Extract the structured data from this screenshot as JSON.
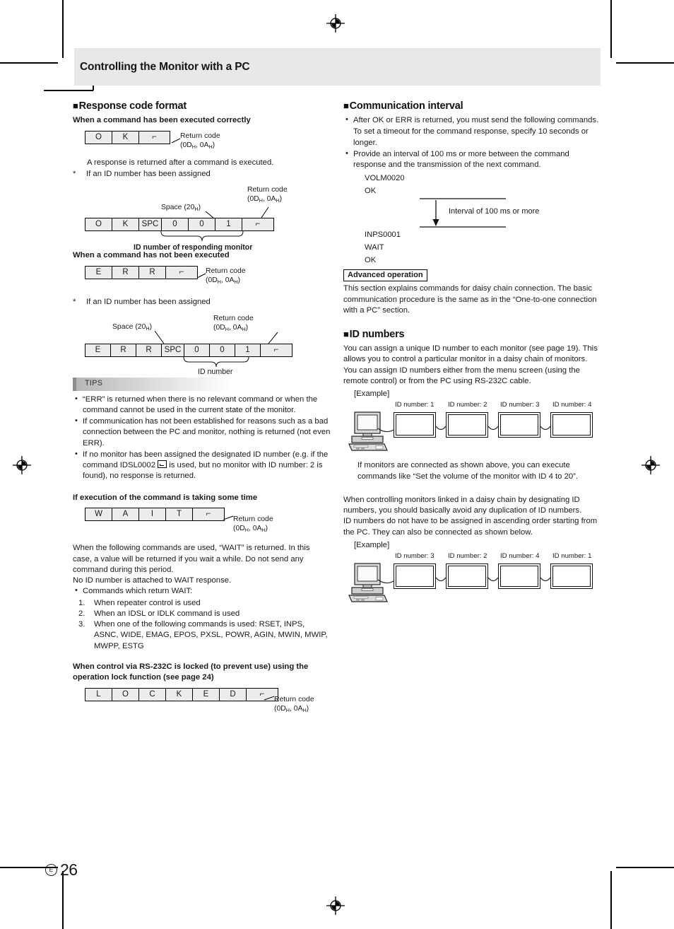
{
  "page": {
    "header_title": "Controlling the Monitor with a PC",
    "page_number": "26",
    "page_mark": "E"
  },
  "left": {
    "s1": {
      "heading": "Response code format",
      "sub1": "When a command has been executed correctly",
      "ok_cells": [
        "O",
        "K",
        "⌐"
      ],
      "return_code_label": "Return code",
      "return_code_hex": "(0DH, 0AH)",
      "note": "A response is returned after a command is executed.",
      "star_note": "If an ID number has been assigned",
      "space_label": "Space (20H)",
      "ok_id_cells": [
        "O",
        "K",
        "SPC",
        "0",
        "0",
        "1",
        "⌐"
      ],
      "brace_label": "ID number of responding monitor",
      "sub2": "When a command has not been executed",
      "err_cells": [
        "E",
        "R",
        "R",
        "⌐"
      ],
      "err_id_cells": [
        "E",
        "R",
        "R",
        "SPC",
        "0",
        "0",
        "1",
        "⌐"
      ],
      "brace_label2": "ID number"
    },
    "tips": {
      "title": "TIPS",
      "items": [
        "“ERR” is returned when there is no relevant command or when the command cannot be used in the current state of the monitor.",
        "If communication has not been established for reasons such as a bad connection between the PC and monitor, nothing is returned (not even ERR).",
        "If no monitor has been assigned the designated ID number (e.g. if the command IDSL0002 ☐ is used, but no monitor with ID number: 2 is found), no response is returned."
      ],
      "item3_pre": "If no monitor has been assigned the designated ID number (e.g. if the command IDSL0002 ",
      "item3_post": " is used, but no monitor with ID number: 2 is found), no response is returned."
    },
    "s2": {
      "sub": "If execution of the command is taking some time",
      "wait_cells": [
        "W",
        "A",
        "I",
        "T",
        "⌐"
      ],
      "p1": "When the following commands are used, “WAIT” is returned. In this case, a value will be returned if you wait a while. Do not send any command during this period.",
      "p2": "No ID number is attached to WAIT response.",
      "bullet": "Commands which return WAIT:",
      "numbered": [
        "When repeater control is used",
        "When an IDSL or IDLK command is used",
        "When one of the following commands is used: RSET, INPS, ASNC, WIDE, EMAG, EPOS, PXSL, POWR, AGIN, MWIN, MWIP, MWPP, ESTG"
      ],
      "num_labels": [
        "1.",
        "2.",
        "3."
      ]
    },
    "s3": {
      "sub": "When control via RS-232C is locked (to prevent use) using the operation lock function (see page 24)",
      "locked_cells": [
        "L",
        "O",
        "C",
        "K",
        "E",
        "D",
        "⌐"
      ]
    }
  },
  "right": {
    "s1": {
      "heading": "Communication interval",
      "bullets": [
        "After OK or ERR is returned, you must send the following commands.",
        "Provide an interval of 100 ms or more between the command response and the transmission of the next command."
      ],
      "bullet1_cont": "To set a timeout for the command response, specify 10 seconds or longer.",
      "seq_top": [
        "VOLM0020",
        "OK"
      ],
      "interval_label": "Interval of 100 ms or more",
      "seq_bottom": [
        "INPS0001",
        "WAIT",
        "OK"
      ]
    },
    "adv": {
      "box_label": "Advanced operation",
      "text": "This section explains commands for daisy chain connection. The basic communication procedure is the same as in the “One-to-one connection with a PC” section."
    },
    "s2": {
      "heading": "ID numbers",
      "p1": "You can assign a unique ID number to each monitor (see page 19). This allows you to control a particular monitor in a daisy chain of monitors.",
      "p2": "You can assign ID numbers either from the menu screen (using the remote control) or from the PC using RS-232C cable.",
      "example_label": "[Example]",
      "chain1_labels": [
        "ID number: 1",
        "ID number: 2",
        "ID number: 3",
        "ID number: 4"
      ],
      "after_chain1": "If monitors are connected as shown above, you can execute commands like “Set the volume of the monitor with ID 4 to 20”.",
      "p3": "When controlling monitors linked in a daisy chain by designating ID numbers, you should basically avoid any duplication of ID numbers.",
      "p4": "ID numbers do not have to be assigned in ascending order starting from the PC. They can also be connected as shown below.",
      "example_label2": "[Example]",
      "chain2_labels": [
        "ID number: 3",
        "ID number: 2",
        "ID number: 4",
        "ID number: 1"
      ]
    }
  }
}
